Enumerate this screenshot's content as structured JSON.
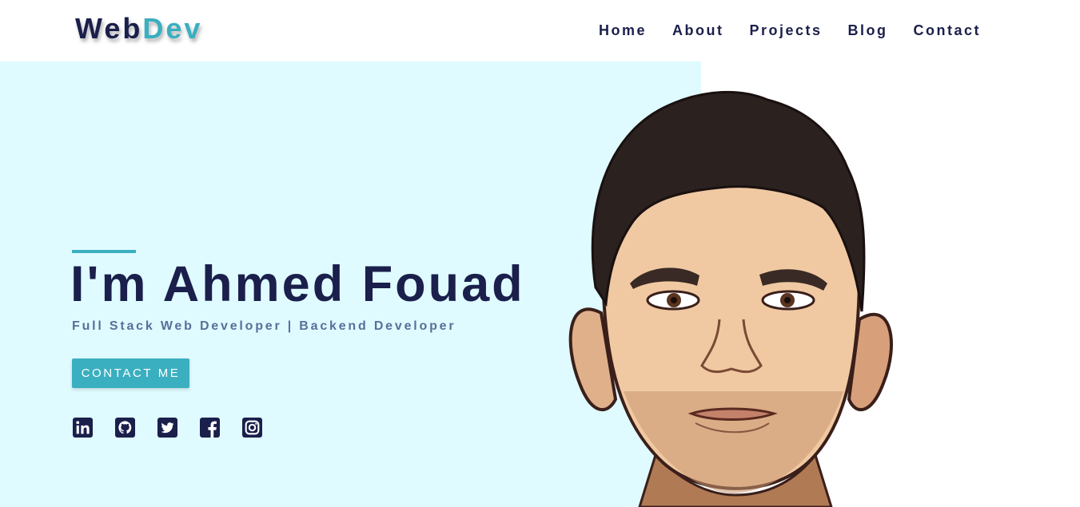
{
  "brand": {
    "part1": "Web",
    "part2": "Dev"
  },
  "nav": {
    "items": [
      {
        "label": "Home"
      },
      {
        "label": "About"
      },
      {
        "label": "Projects"
      },
      {
        "label": "Blog"
      },
      {
        "label": "Contact"
      }
    ]
  },
  "hero": {
    "title": "I'm Ahmed Fouad",
    "subtitle": "Full Stack Web Developer | Backend Developer",
    "cta_label": "CONTACT ME"
  },
  "socials": [
    {
      "icon": "linkedin-icon"
    },
    {
      "icon": "github-icon"
    },
    {
      "icon": "twitter-icon"
    },
    {
      "icon": "facebook-icon"
    },
    {
      "icon": "instagram-icon"
    }
  ],
  "colors": {
    "navy": "#1a1f4b",
    "accent": "#3aafc0",
    "hero_background": "#dffbff",
    "subtitle": "#5a6f9a"
  }
}
